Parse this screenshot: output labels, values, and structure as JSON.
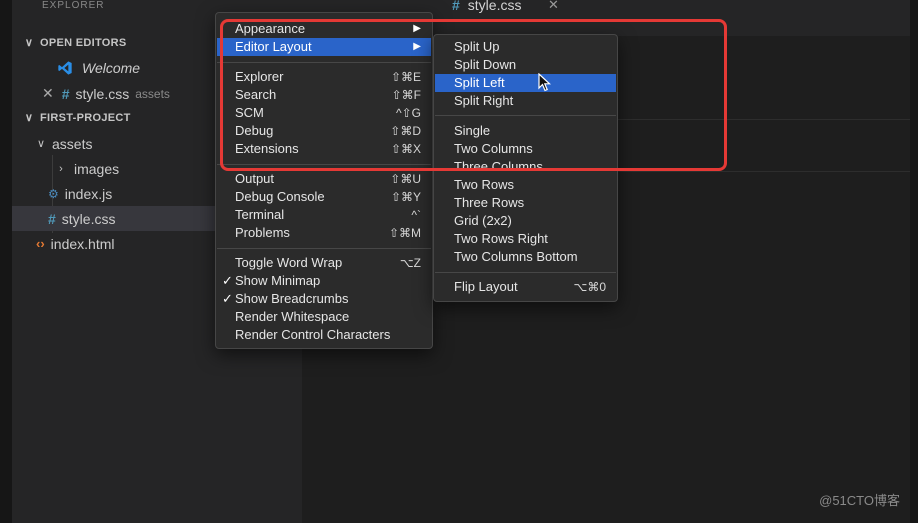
{
  "sidebar": {
    "title": "EXPLORER",
    "open_editors_label": "OPEN EDITORS",
    "open_editors": [
      {
        "name": "Welcome"
      },
      {
        "name": "style.css",
        "folder": "assets"
      }
    ],
    "project_label": "FIRST-PROJECT",
    "tree": {
      "assets": "assets",
      "images": "images",
      "index_js": "index.js",
      "style_css": "style.css",
      "index_html": "index.html"
    }
  },
  "editor": {
    "tab_label": "style.css",
    "tab_close": "✕"
  },
  "view_menu": {
    "items": [
      {
        "label": "Appearance",
        "shortcut": "▶"
      },
      {
        "label": "Editor Layout",
        "shortcut": "▶"
      },
      {
        "label": "Explorer",
        "shortcut": "⇧⌘E"
      },
      {
        "label": "Search",
        "shortcut": "⇧⌘F"
      },
      {
        "label": "SCM",
        "shortcut": "^⇧G"
      },
      {
        "label": "Debug",
        "shortcut": "⇧⌘D"
      },
      {
        "label": "Extensions",
        "shortcut": "⇧⌘X"
      },
      {
        "label": "Output",
        "shortcut": "⇧⌘U"
      },
      {
        "label": "Debug Console",
        "shortcut": "⇧⌘Y"
      },
      {
        "label": "Terminal",
        "shortcut": "^`"
      },
      {
        "label": "Problems",
        "shortcut": "⇧⌘M"
      },
      {
        "label": "Toggle Word Wrap",
        "shortcut": "⌥Z"
      },
      {
        "label": "Show Minimap",
        "shortcut": ""
      },
      {
        "label": "Show Breadcrumbs",
        "shortcut": ""
      },
      {
        "label": "Render Whitespace",
        "shortcut": ""
      },
      {
        "label": "Render Control Characters",
        "shortcut": ""
      }
    ],
    "checkmark": "✓"
  },
  "layout_menu": {
    "items": [
      {
        "label": "Split Up"
      },
      {
        "label": "Split Down"
      },
      {
        "label": "Split Left"
      },
      {
        "label": "Split Right"
      },
      {
        "label": "Single"
      },
      {
        "label": "Two Columns"
      },
      {
        "label": "Three Columns"
      },
      {
        "label": "Two Rows"
      },
      {
        "label": "Three Rows"
      },
      {
        "label": "Grid (2x2)"
      },
      {
        "label": "Two Rows Right"
      },
      {
        "label": "Two Columns Bottom"
      },
      {
        "label": "Flip Layout",
        "shortcut": "⌥⌘0"
      }
    ]
  },
  "colors": {
    "highlight": "#2a64c9",
    "annotation": "#e53935",
    "menu_bg": "#2b2b2b",
    "sidebar_bg": "#252526"
  },
  "watermark": "@51CTO博客"
}
